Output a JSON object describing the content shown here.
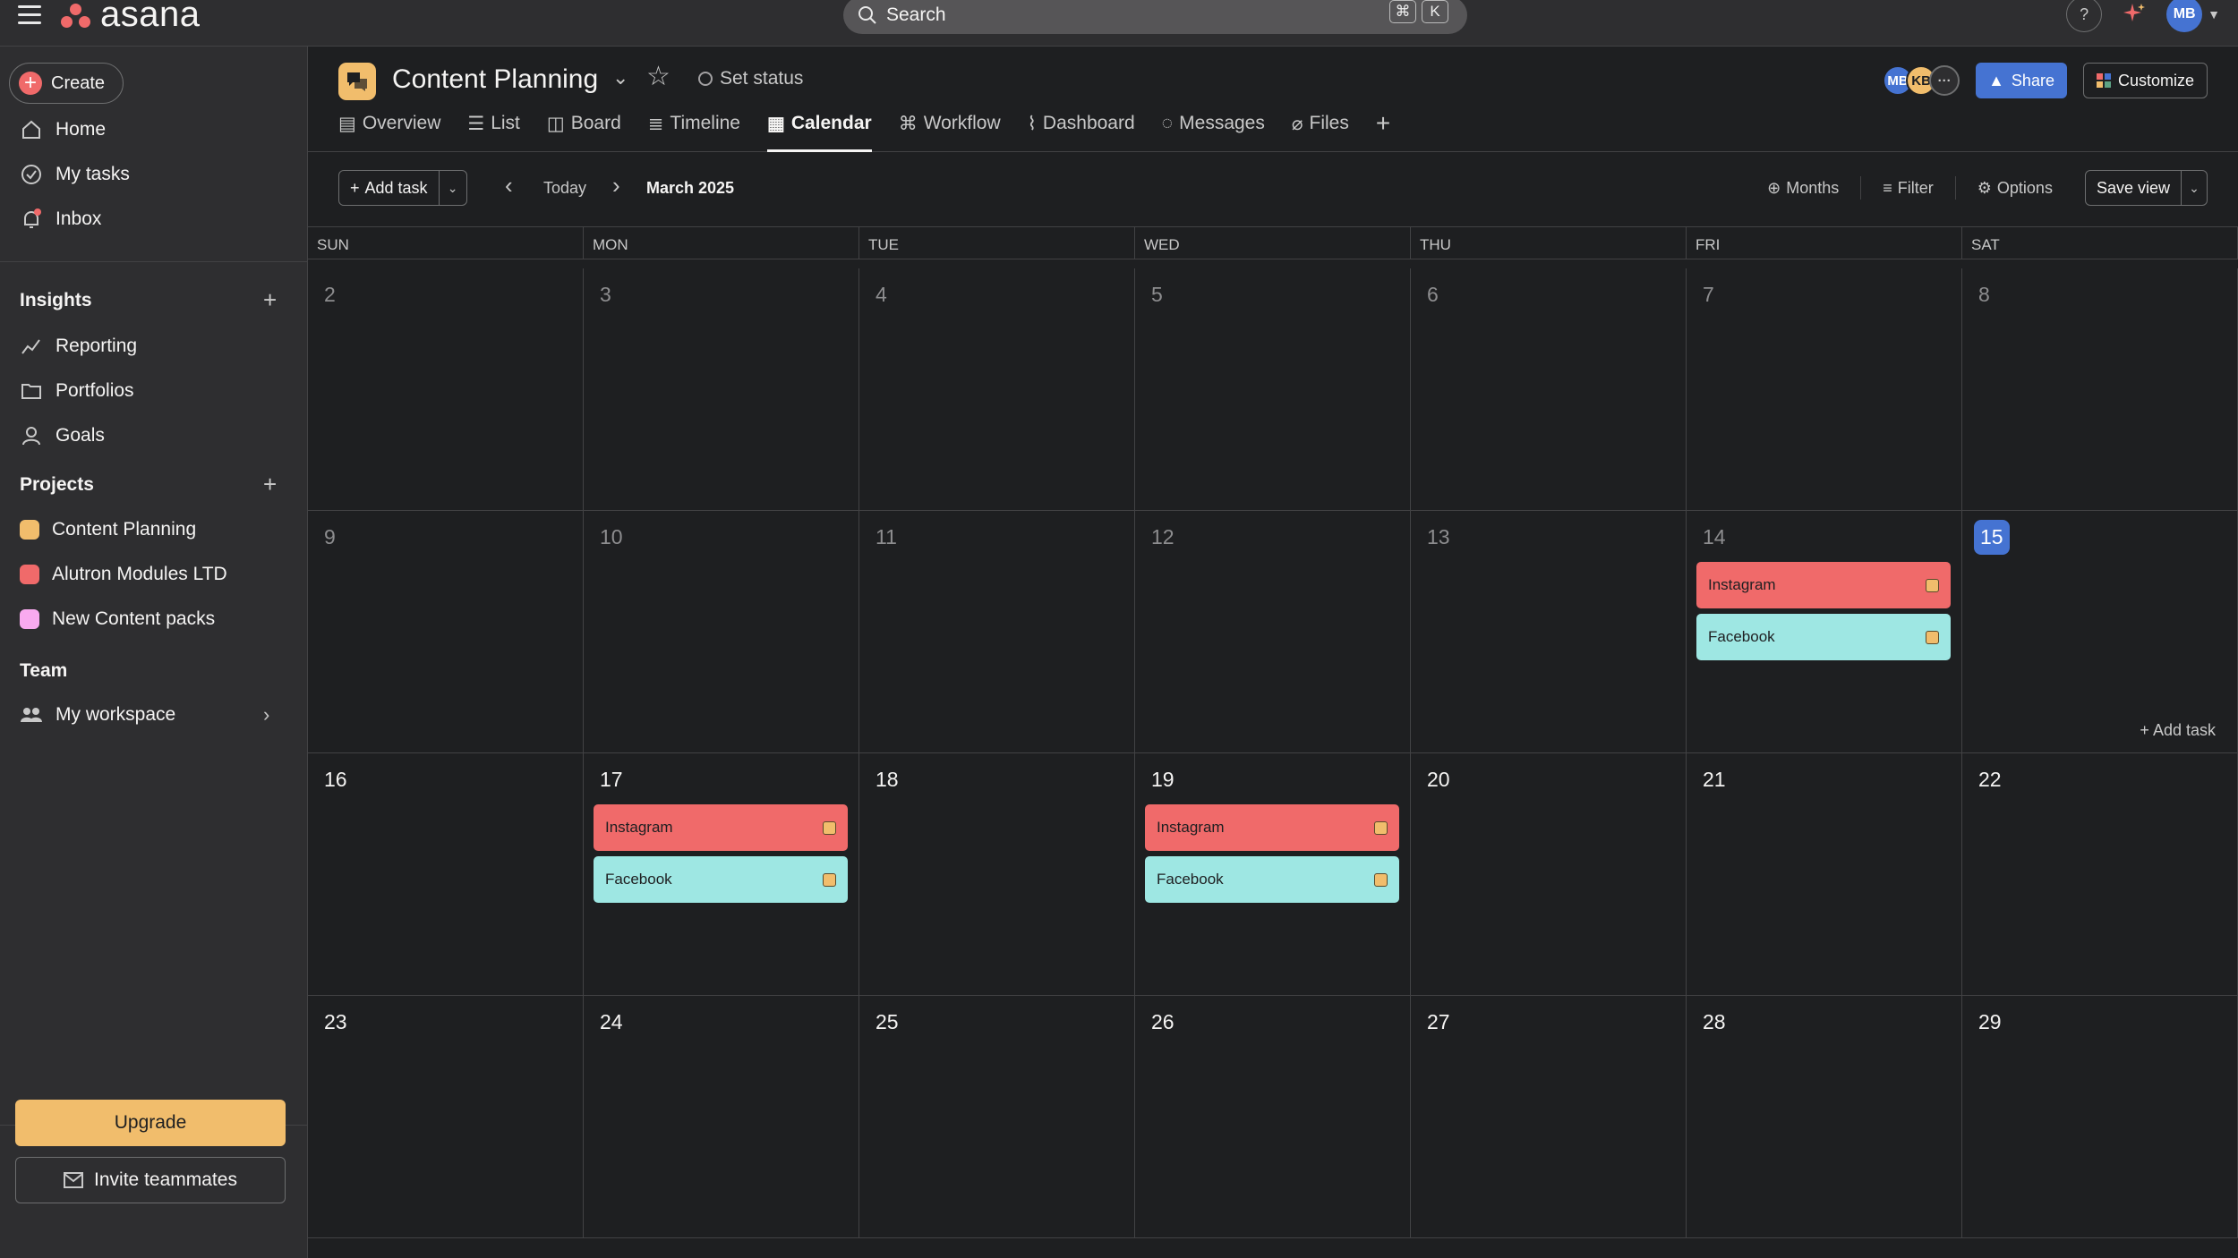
{
  "app": {
    "logo_text": "asana",
    "brand_color": "#f06a6a"
  },
  "topbar": {
    "search_label": "Search",
    "kbd_cmd": "⌘",
    "kbd_key": "K",
    "help": "?",
    "user_initials": "MB"
  },
  "sidebar": {
    "create": "Create",
    "nav": [
      {
        "label": "Home"
      },
      {
        "label": "My tasks"
      },
      {
        "label": "Inbox"
      }
    ],
    "insights_header": "Insights",
    "insights": [
      {
        "label": "Reporting"
      },
      {
        "label": "Portfolios"
      },
      {
        "label": "Goals"
      }
    ],
    "projects_header": "Projects",
    "projects": [
      {
        "label": "Content Planning",
        "color": "#f1bd6c"
      },
      {
        "label": "Alutron Modules LTD",
        "color": "#f06a6a"
      },
      {
        "label": "New Content packs",
        "color": "#f9aaef"
      }
    ],
    "team_header": "Team",
    "team_item": "My workspace",
    "upgrade": "Upgrade",
    "invite": "Invite teammates"
  },
  "project": {
    "title": "Content Planning",
    "set_status": "Set status",
    "tabs": [
      {
        "label": "Overview"
      },
      {
        "label": "List"
      },
      {
        "label": "Board"
      },
      {
        "label": "Timeline"
      },
      {
        "label": "Calendar"
      },
      {
        "label": "Workflow"
      },
      {
        "label": "Dashboard"
      },
      {
        "label": "Messages"
      },
      {
        "label": "Files"
      }
    ],
    "members": [
      "MB",
      "KB"
    ],
    "share": "Share",
    "customize": "Customize"
  },
  "toolbar": {
    "add_task": "Add task",
    "today": "Today",
    "month": "March 2025",
    "months": "Months",
    "filter": "Filter",
    "options": "Options",
    "save_view": "Save view"
  },
  "calendar": {
    "weekdays": [
      "SUN",
      "MON",
      "TUE",
      "WED",
      "THU",
      "FRI",
      "SAT"
    ],
    "weeks": [
      [
        "2",
        "3",
        "4",
        "5",
        "6",
        "7",
        "8"
      ],
      [
        "9",
        "10",
        "11",
        "12",
        "13",
        "14",
        "15"
      ],
      [
        "16",
        "17",
        "18",
        "19",
        "20",
        "21",
        "22"
      ],
      [
        "23",
        "24",
        "25",
        "26",
        "27",
        "28",
        "29"
      ]
    ],
    "today": "15",
    "add_task_hover": "Add task",
    "tasks": {
      "instagram": "Instagram",
      "facebook": "Facebook"
    }
  }
}
